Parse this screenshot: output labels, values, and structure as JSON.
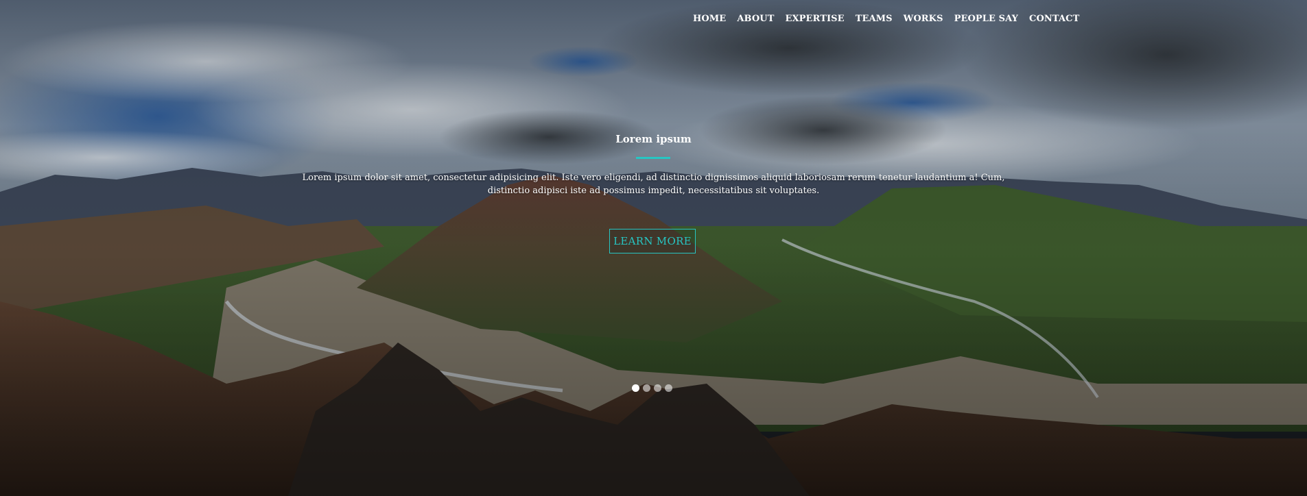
{
  "nav": {
    "items": [
      {
        "label": "HOME"
      },
      {
        "label": "ABOUT"
      },
      {
        "label": "EXPERTISE"
      },
      {
        "label": "TEAMS"
      },
      {
        "label": "WORKS"
      },
      {
        "label": "PEOPLE SAY"
      },
      {
        "label": "CONTACT"
      }
    ]
  },
  "hero": {
    "title": "Lorem ipsum",
    "description": "Lorem ipsum dolor sit amet, consectetur adipisicing elit. Iste vero eligendi, ad distinctio dignissimos aliquid laboriosam rerum tenetur laudantium a! Cum, distinctio adipisci iste ad possimus impedit, necessitatibus sit voluptates.",
    "cta_label": "LEARN MORE",
    "slides_total": 4,
    "slide_active": 1
  },
  "colors": {
    "accent": "#27c6c3",
    "text": "#ffffff"
  }
}
